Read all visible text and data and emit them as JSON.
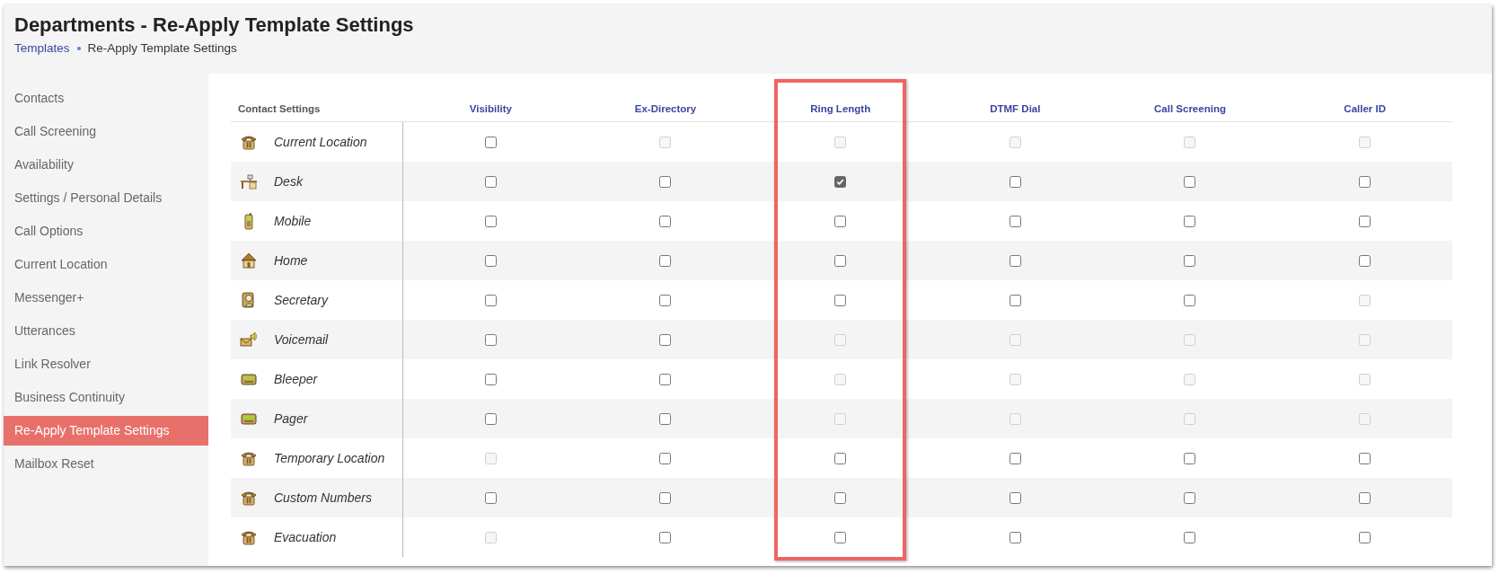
{
  "page": {
    "title": "Departments - Re-Apply Template Settings",
    "breadcrumb": [
      {
        "label": "Templates",
        "link": true
      },
      {
        "label": "Re-Apply Template Settings",
        "link": false
      }
    ]
  },
  "sidebar": {
    "items": [
      {
        "label": "Contacts",
        "selected": false
      },
      {
        "label": "Call Screening",
        "selected": false
      },
      {
        "label": "Availability",
        "selected": false
      },
      {
        "label": "Settings / Personal Details",
        "selected": false
      },
      {
        "label": "Call Options",
        "selected": false
      },
      {
        "label": "Current Location",
        "selected": false
      },
      {
        "label": "Messenger+",
        "selected": false
      },
      {
        "label": "Utterances",
        "selected": false
      },
      {
        "label": "Link Resolver",
        "selected": false
      },
      {
        "label": "Business Continuity",
        "selected": false
      },
      {
        "label": "Re-Apply Template Settings",
        "selected": true
      },
      {
        "label": "Mailbox Reset",
        "selected": false
      }
    ]
  },
  "table": {
    "first_column": "Contact Settings",
    "columns": [
      {
        "label": "Visibility",
        "highlighted": false
      },
      {
        "label": "Ex-Directory",
        "highlighted": false
      },
      {
        "label": "Ring Length",
        "highlighted": true
      },
      {
        "label": "DTMF Dial",
        "highlighted": false
      },
      {
        "label": "Call Screening",
        "highlighted": false
      },
      {
        "label": "Caller ID",
        "highlighted": false
      }
    ],
    "rows": [
      {
        "label": "Current Location",
        "kind": "phone",
        "cells": [
          {
            "checked": false,
            "disabled": false
          },
          {
            "checked": false,
            "disabled": true
          },
          {
            "checked": false,
            "disabled": true
          },
          {
            "checked": false,
            "disabled": true
          },
          {
            "checked": false,
            "disabled": true
          },
          {
            "checked": false,
            "disabled": true
          }
        ]
      },
      {
        "label": "Desk",
        "kind": "desk",
        "cells": [
          {
            "checked": false,
            "disabled": false
          },
          {
            "checked": false,
            "disabled": false
          },
          {
            "checked": true,
            "disabled": false
          },
          {
            "checked": false,
            "disabled": false
          },
          {
            "checked": false,
            "disabled": false
          },
          {
            "checked": false,
            "disabled": false
          }
        ]
      },
      {
        "label": "Mobile",
        "kind": "mobile",
        "cells": [
          {
            "checked": false,
            "disabled": false
          },
          {
            "checked": false,
            "disabled": false
          },
          {
            "checked": false,
            "disabled": false
          },
          {
            "checked": false,
            "disabled": false
          },
          {
            "checked": false,
            "disabled": false
          },
          {
            "checked": false,
            "disabled": false
          }
        ]
      },
      {
        "label": "Home",
        "kind": "home",
        "cells": [
          {
            "checked": false,
            "disabled": false
          },
          {
            "checked": false,
            "disabled": false
          },
          {
            "checked": false,
            "disabled": false
          },
          {
            "checked": false,
            "disabled": false
          },
          {
            "checked": false,
            "disabled": false
          },
          {
            "checked": false,
            "disabled": false
          }
        ]
      },
      {
        "label": "Secretary",
        "kind": "secretary",
        "cells": [
          {
            "checked": false,
            "disabled": false
          },
          {
            "checked": false,
            "disabled": false
          },
          {
            "checked": false,
            "disabled": false
          },
          {
            "checked": false,
            "disabled": false
          },
          {
            "checked": false,
            "disabled": false
          },
          {
            "checked": false,
            "disabled": true
          }
        ]
      },
      {
        "label": "Voicemail",
        "kind": "voicemail",
        "cells": [
          {
            "checked": false,
            "disabled": false
          },
          {
            "checked": false,
            "disabled": false
          },
          {
            "checked": false,
            "disabled": true
          },
          {
            "checked": false,
            "disabled": true
          },
          {
            "checked": false,
            "disabled": true
          },
          {
            "checked": false,
            "disabled": true
          }
        ]
      },
      {
        "label": "Bleeper",
        "kind": "pager",
        "cells": [
          {
            "checked": false,
            "disabled": false
          },
          {
            "checked": false,
            "disabled": false
          },
          {
            "checked": false,
            "disabled": true
          },
          {
            "checked": false,
            "disabled": true
          },
          {
            "checked": false,
            "disabled": true
          },
          {
            "checked": false,
            "disabled": true
          }
        ]
      },
      {
        "label": "Pager",
        "kind": "pager",
        "cells": [
          {
            "checked": false,
            "disabled": false
          },
          {
            "checked": false,
            "disabled": false
          },
          {
            "checked": false,
            "disabled": true
          },
          {
            "checked": false,
            "disabled": true
          },
          {
            "checked": false,
            "disabled": true
          },
          {
            "checked": false,
            "disabled": true
          }
        ]
      },
      {
        "label": "Temporary Location",
        "kind": "phone",
        "cells": [
          {
            "checked": false,
            "disabled": true
          },
          {
            "checked": false,
            "disabled": false
          },
          {
            "checked": false,
            "disabled": false
          },
          {
            "checked": false,
            "disabled": false
          },
          {
            "checked": false,
            "disabled": false
          },
          {
            "checked": false,
            "disabled": false
          }
        ]
      },
      {
        "label": "Custom Numbers",
        "kind": "phone",
        "cells": [
          {
            "checked": false,
            "disabled": false
          },
          {
            "checked": false,
            "disabled": false
          },
          {
            "checked": false,
            "disabled": false
          },
          {
            "checked": false,
            "disabled": false
          },
          {
            "checked": false,
            "disabled": false
          },
          {
            "checked": false,
            "disabled": false
          }
        ]
      },
      {
        "label": "Evacuation",
        "kind": "phone",
        "cells": [
          {
            "checked": false,
            "disabled": true
          },
          {
            "checked": false,
            "disabled": false
          },
          {
            "checked": false,
            "disabled": false
          },
          {
            "checked": false,
            "disabled": false
          },
          {
            "checked": false,
            "disabled": false
          },
          {
            "checked": false,
            "disabled": false
          }
        ]
      }
    ]
  }
}
